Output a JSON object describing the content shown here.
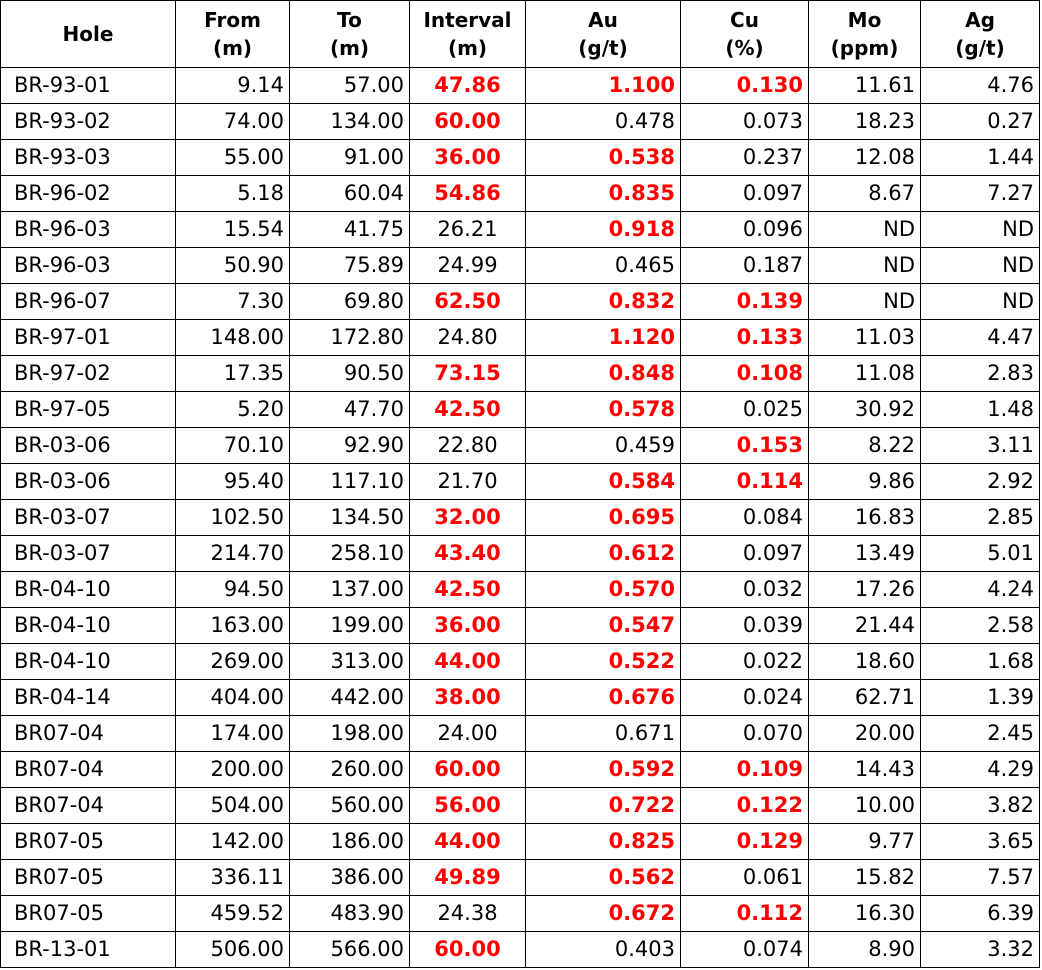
{
  "headers": [
    {
      "line1": "Hole",
      "line2": ""
    },
    {
      "line1": "From",
      "line2": "(m)"
    },
    {
      "line1": "To",
      "line2": "(m)"
    },
    {
      "line1": "Interval",
      "line2": "(m)"
    },
    {
      "line1": "Au",
      "line2": "(g/t)"
    },
    {
      "line1": "Cu",
      "line2": "(%)"
    },
    {
      "line1": "Mo",
      "line2": "(ppm)"
    },
    {
      "line1": "Ag",
      "line2": "(g/t)"
    }
  ],
  "highlight_color": "#ff0000",
  "rows": [
    {
      "hole": "BR-93-01",
      "from": "9.14",
      "to": "57.00",
      "interval": "47.86",
      "au": "1.100",
      "cu": "0.130",
      "mo": "11.61",
      "ag": "4.76",
      "hl_interval": true,
      "hl_au": true,
      "hl_cu": true
    },
    {
      "hole": "BR-93-02",
      "from": "74.00",
      "to": "134.00",
      "interval": "60.00",
      "au": "0.478",
      "cu": "0.073",
      "mo": "18.23",
      "ag": "0.27",
      "hl_interval": true,
      "hl_au": false,
      "hl_cu": false
    },
    {
      "hole": "BR-93-03",
      "from": "55.00",
      "to": "91.00",
      "interval": "36.00",
      "au": "0.538",
      "cu": "0.237",
      "mo": "12.08",
      "ag": "1.44",
      "hl_interval": true,
      "hl_au": true,
      "hl_cu": false
    },
    {
      "hole": "BR-96-02",
      "from": "5.18",
      "to": "60.04",
      "interval": "54.86",
      "au": "0.835",
      "cu": "0.097",
      "mo": "8.67",
      "ag": "7.27",
      "hl_interval": true,
      "hl_au": true,
      "hl_cu": false
    },
    {
      "hole": "BR-96-03",
      "from": "15.54",
      "to": "41.75",
      "interval": "26.21",
      "au": "0.918",
      "cu": "0.096",
      "mo": "ND",
      "ag": "ND",
      "hl_interval": false,
      "hl_au": true,
      "hl_cu": false
    },
    {
      "hole": "BR-96-03",
      "from": "50.90",
      "to": "75.89",
      "interval": "24.99",
      "au": "0.465",
      "cu": "0.187",
      "mo": "ND",
      "ag": "ND",
      "hl_interval": false,
      "hl_au": false,
      "hl_cu": false
    },
    {
      "hole": "BR-96-07",
      "from": "7.30",
      "to": "69.80",
      "interval": "62.50",
      "au": "0.832",
      "cu": "0.139",
      "mo": "ND",
      "ag": "ND",
      "hl_interval": true,
      "hl_au": true,
      "hl_cu": true
    },
    {
      "hole": "BR-97-01",
      "from": "148.00",
      "to": "172.80",
      "interval": "24.80",
      "au": "1.120",
      "cu": "0.133",
      "mo": "11.03",
      "ag": "4.47",
      "hl_interval": false,
      "hl_au": true,
      "hl_cu": true
    },
    {
      "hole": "BR-97-02",
      "from": "17.35",
      "to": "90.50",
      "interval": "73.15",
      "au": "0.848",
      "cu": "0.108",
      "mo": "11.08",
      "ag": "2.83",
      "hl_interval": true,
      "hl_au": true,
      "hl_cu": true
    },
    {
      "hole": "BR-97-05",
      "from": "5.20",
      "to": "47.70",
      "interval": "42.50",
      "au": "0.578",
      "cu": "0.025",
      "mo": "30.92",
      "ag": "1.48",
      "hl_interval": true,
      "hl_au": true,
      "hl_cu": false
    },
    {
      "hole": "BR-03-06",
      "from": "70.10",
      "to": "92.90",
      "interval": "22.80",
      "au": "0.459",
      "cu": "0.153",
      "mo": "8.22",
      "ag": "3.11",
      "hl_interval": false,
      "hl_au": false,
      "hl_cu": true
    },
    {
      "hole": "BR-03-06",
      "from": "95.40",
      "to": "117.10",
      "interval": "21.70",
      "au": "0.584",
      "cu": "0.114",
      "mo": "9.86",
      "ag": "2.92",
      "hl_interval": false,
      "hl_au": true,
      "hl_cu": true
    },
    {
      "hole": "BR-03-07",
      "from": "102.50",
      "to": "134.50",
      "interval": "32.00",
      "au": "0.695",
      "cu": "0.084",
      "mo": "16.83",
      "ag": "2.85",
      "hl_interval": true,
      "hl_au": true,
      "hl_cu": false
    },
    {
      "hole": "BR-03-07",
      "from": "214.70",
      "to": "258.10",
      "interval": "43.40",
      "au": "0.612",
      "cu": "0.097",
      "mo": "13.49",
      "ag": "5.01",
      "hl_interval": true,
      "hl_au": true,
      "hl_cu": false
    },
    {
      "hole": "BR-04-10",
      "from": "94.50",
      "to": "137.00",
      "interval": "42.50",
      "au": "0.570",
      "cu": "0.032",
      "mo": "17.26",
      "ag": "4.24",
      "hl_interval": true,
      "hl_au": true,
      "hl_cu": false
    },
    {
      "hole": "BR-04-10",
      "from": "163.00",
      "to": "199.00",
      "interval": "36.00",
      "au": "0.547",
      "cu": "0.039",
      "mo": "21.44",
      "ag": "2.58",
      "hl_interval": true,
      "hl_au": true,
      "hl_cu": false
    },
    {
      "hole": "BR-04-10",
      "from": "269.00",
      "to": "313.00",
      "interval": "44.00",
      "au": "0.522",
      "cu": "0.022",
      "mo": "18.60",
      "ag": "1.68",
      "hl_interval": true,
      "hl_au": true,
      "hl_cu": false
    },
    {
      "hole": "BR-04-14",
      "from": "404.00",
      "to": "442.00",
      "interval": "38.00",
      "au": "0.676",
      "cu": "0.024",
      "mo": "62.71",
      "ag": "1.39",
      "hl_interval": true,
      "hl_au": true,
      "hl_cu": false
    },
    {
      "hole": "BR07-04",
      "from": "174.00",
      "to": "198.00",
      "interval": "24.00",
      "au": "0.671",
      "cu": "0.070",
      "mo": "20.00",
      "ag": "2.45",
      "hl_interval": false,
      "hl_au": false,
      "hl_cu": false
    },
    {
      "hole": "BR07-04",
      "from": "200.00",
      "to": "260.00",
      "interval": "60.00",
      "au": "0.592",
      "cu": "0.109",
      "mo": "14.43",
      "ag": "4.29",
      "hl_interval": true,
      "hl_au": true,
      "hl_cu": true
    },
    {
      "hole": "BR07-04",
      "from": "504.00",
      "to": "560.00",
      "interval": "56.00",
      "au": "0.722",
      "cu": "0.122",
      "mo": "10.00",
      "ag": "3.82",
      "hl_interval": true,
      "hl_au": true,
      "hl_cu": true
    },
    {
      "hole": "BR07-05",
      "from": "142.00",
      "to": "186.00",
      "interval": "44.00",
      "au": "0.825",
      "cu": "0.129",
      "mo": "9.77",
      "ag": "3.65",
      "hl_interval": true,
      "hl_au": true,
      "hl_cu": true
    },
    {
      "hole": "BR07-05",
      "from": "336.11",
      "to": "386.00",
      "interval": "49.89",
      "au": "0.562",
      "cu": "0.061",
      "mo": "15.82",
      "ag": "7.57",
      "hl_interval": true,
      "hl_au": true,
      "hl_cu": false
    },
    {
      "hole": "BR07-05",
      "from": "459.52",
      "to": "483.90",
      "interval": "24.38",
      "au": "0.672",
      "cu": "0.112",
      "mo": "16.30",
      "ag": "6.39",
      "hl_interval": false,
      "hl_au": true,
      "hl_cu": true
    },
    {
      "hole": "BR-13-01",
      "from": "506.00",
      "to": "566.00",
      "interval": "60.00",
      "au": "0.403",
      "cu": "0.074",
      "mo": "8.90",
      "ag": "3.32",
      "hl_interval": true,
      "hl_au": false,
      "hl_cu": false
    }
  ]
}
